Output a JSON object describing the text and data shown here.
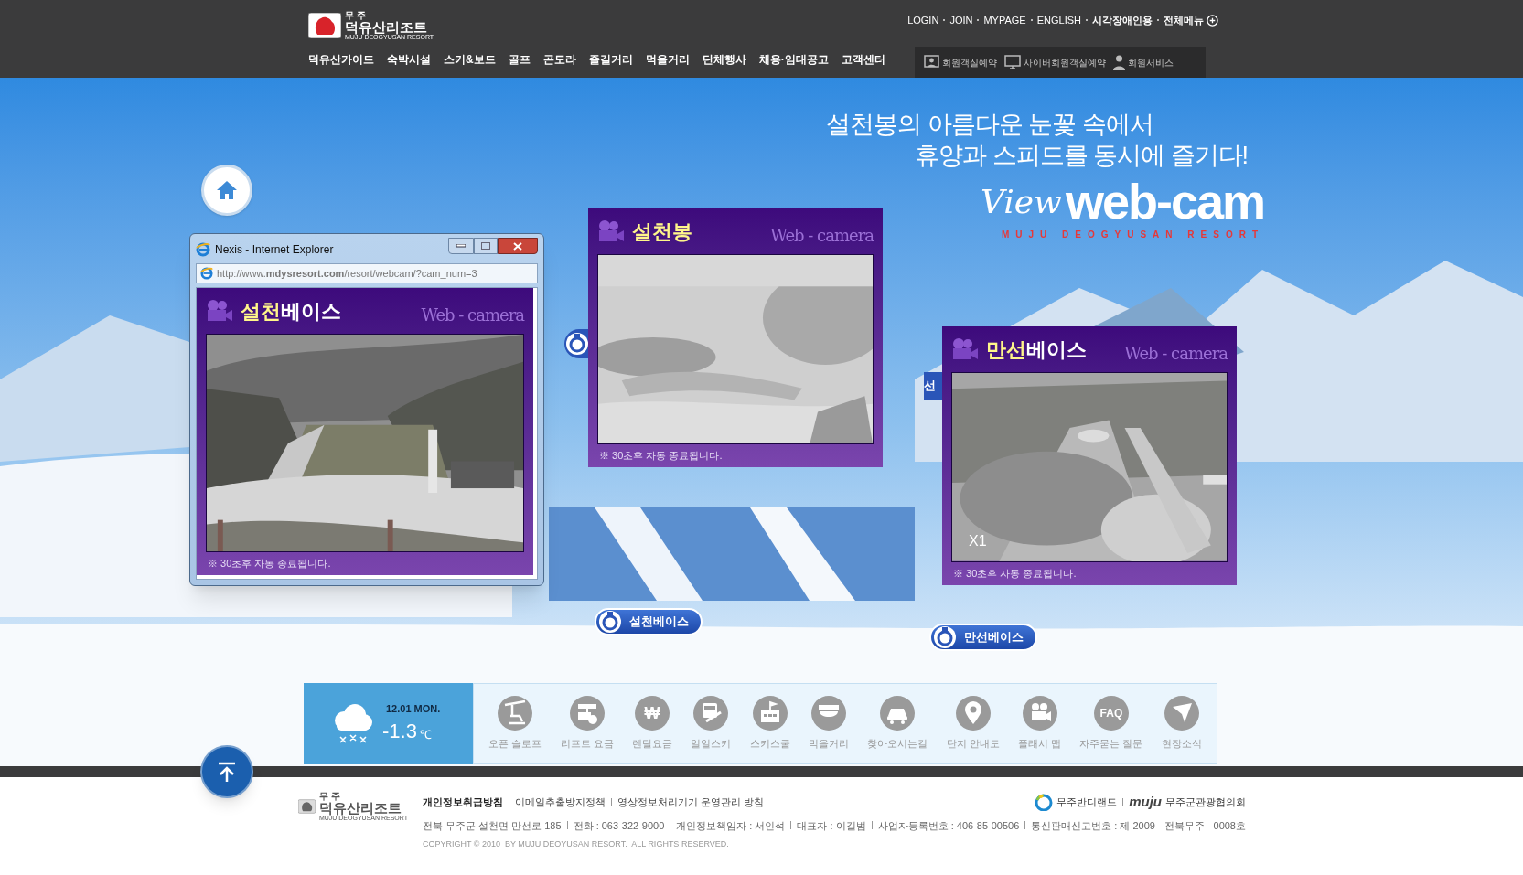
{
  "header": {
    "logo": {
      "small": "무 주",
      "name": "덕유산리조트",
      "tagline": "MUJU DEOGYUSAN RESORT"
    },
    "top_links": [
      "LOGIN",
      "JOIN",
      "MYPAGE",
      "ENGLISH",
      "시각장애인용",
      "전체메뉴"
    ],
    "nav": [
      "덕유산가이드",
      "숙박시설",
      "스키&보드",
      "골프",
      "곤도라",
      "즐길거리",
      "먹을거리",
      "단체행사",
      "채용·임대공고",
      "고객센터"
    ],
    "member_links": [
      "회원객실예약",
      "사이버회원객실예약",
      "회원서비스"
    ]
  },
  "hero": {
    "headline": [
      "설천봉의 아름다운 눈꽃 속에서",
      "휴양과 스피드를 동시에 즐기다!"
    ],
    "logo": {
      "script": "View",
      "word": "web-cam",
      "sub": "MUJU DEOGYUSAN RESORT"
    }
  },
  "popup": {
    "title": "Nexis - Internet Explorer",
    "url": "http://www.**mdysresort.com**/resort/webcam/?cam_num=3"
  },
  "cams": [
    {
      "title_accent": "설천",
      "title": "베이스",
      "brand": "Web - camera",
      "note": "※ 30초후 자동 종료됩니다."
    },
    {
      "title_accent": "설천봉",
      "brand": "Web - camera",
      "note": "※ 30초후 자동 종료됩니다."
    },
    {
      "title_accent": "만선",
      "title": "베이스",
      "brand": "Web - camera",
      "note": "※ 30초후 자동 종료됩니다.",
      "overlay": "X1"
    }
  ],
  "base_buttons": [
    "설천베이스",
    "만선베이스"
  ],
  "hidden_tab": "선",
  "weather": {
    "date": "12.01 MON.",
    "temp": "-1.3",
    "unit": "℃"
  },
  "quick_links": [
    {
      "label": "오픈 슬로프"
    },
    {
      "label": "리프트 요금"
    },
    {
      "label": "렌탈요금",
      "glyph": "₩"
    },
    {
      "label": "일일스키"
    },
    {
      "label": "스키스쿨"
    },
    {
      "label": "먹을거리"
    },
    {
      "label": "찾아오시는길"
    },
    {
      "label": "단지 안내도"
    },
    {
      "label": "플래시 맵"
    },
    {
      "label": "자주묻는 질문",
      "glyph": "FAQ"
    },
    {
      "label": "현장소식"
    }
  ],
  "footer": {
    "logo": {
      "small": "무 주",
      "name": "덕유산리조트",
      "tagline": "MUJU DEOGYUSAN RESORT"
    },
    "policies": [
      "개인정보취급방침",
      "이메일추출방지정책",
      "영상정보처리기기 운영관리 방침"
    ],
    "info": [
      "전북 무주군 설천면 만선로 185",
      "전화 : 063-322-9000",
      "개인정보책임자 : 서인석",
      "대표자 : 이길범",
      "사업자등록번호 : 406-85-00506",
      "통신판매신고번호 : 제 2009 - 전북무주 - 0008호"
    ],
    "copyright": "COPYRIGHT © 2010  BY MUJU DEOYUSAN RESORT.  ALL RIGHTS RESERVED.",
    "partners": [
      {
        "label": "무주반디랜드"
      },
      {
        "logo": "muju",
        "label": "무주군관광협의회"
      }
    ]
  }
}
